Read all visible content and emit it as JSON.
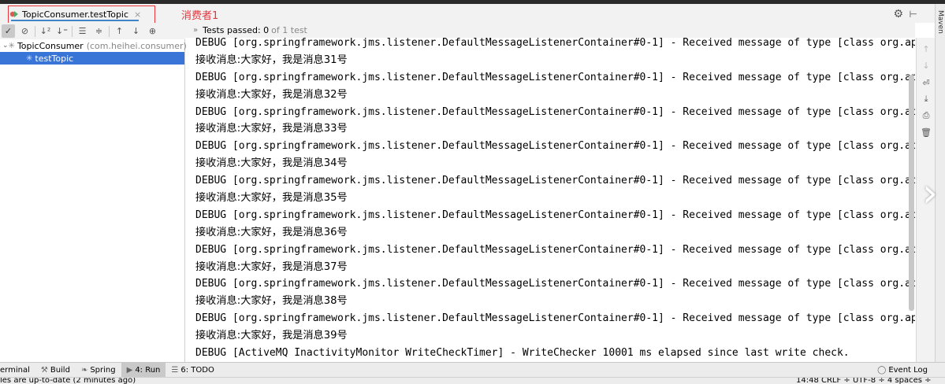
{
  "run_tab": {
    "title": "TopicConsumer.testTopic",
    "close_glyph": "×"
  },
  "annotation": {
    "label": "消费者1",
    "color": "#e8343b"
  },
  "right_strip": {
    "label": "Maven"
  },
  "test_status": {
    "prefix": "»",
    "main": "Tests passed: 0",
    "sub": "of 1 test"
  },
  "test_tree": {
    "root_label": "TopicConsumer",
    "root_package": "(com.heihei.consumer)",
    "child_label": "testTopic"
  },
  "console": {
    "lines": [
      {
        "kind": "debug",
        "text": "DEBUG [org.springframework.jms.listener.DefaultMessageListenerContainer#0-1] - Received message of type [class org.apa"
      },
      {
        "kind": "recv",
        "text": "接收消息:大家好，我是消息31号"
      },
      {
        "kind": "debug",
        "text": "DEBUG [org.springframework.jms.listener.DefaultMessageListenerContainer#0-1] - Received message of type [class org.apa"
      },
      {
        "kind": "recv",
        "text": "接收消息:大家好，我是消息32号"
      },
      {
        "kind": "debug",
        "text": "DEBUG [org.springframework.jms.listener.DefaultMessageListenerContainer#0-1] - Received message of type [class org.apa"
      },
      {
        "kind": "recv",
        "text": "接收消息:大家好，我是消息33号"
      },
      {
        "kind": "debug",
        "text": "DEBUG [org.springframework.jms.listener.DefaultMessageListenerContainer#0-1] - Received message of type [class org.apa"
      },
      {
        "kind": "recv",
        "text": "接收消息:大家好，我是消息34号"
      },
      {
        "kind": "debug",
        "text": "DEBUG [org.springframework.jms.listener.DefaultMessageListenerContainer#0-1] - Received message of type [class org.apa"
      },
      {
        "kind": "recv",
        "text": "接收消息:大家好，我是消息35号"
      },
      {
        "kind": "debug",
        "text": "DEBUG [org.springframework.jms.listener.DefaultMessageListenerContainer#0-1] - Received message of type [class org.apa"
      },
      {
        "kind": "recv",
        "text": "接收消息:大家好，我是消息36号"
      },
      {
        "kind": "debug",
        "text": "DEBUG [org.springframework.jms.listener.DefaultMessageListenerContainer#0-1] - Received message of type [class org.apa"
      },
      {
        "kind": "recv",
        "text": "接收消息:大家好，我是消息37号"
      },
      {
        "kind": "debug",
        "text": "DEBUG [org.springframework.jms.listener.DefaultMessageListenerContainer#0-1] - Received message of type [class org.apa"
      },
      {
        "kind": "recv",
        "text": "接收消息:大家好，我是消息38号"
      },
      {
        "kind": "debug",
        "text": "DEBUG [org.springframework.jms.listener.DefaultMessageListenerContainer#0-1] - Received message of type [class org.apa"
      },
      {
        "kind": "recv",
        "text": "接收消息:大家好，我是消息39号"
      },
      {
        "kind": "debug",
        "text": "DEBUG [ActiveMQ InactivityMonitor WriteCheckTimer] - WriteChecker 10001 ms elapsed since last write check."
      }
    ]
  },
  "bottom_tools": {
    "terminal": "erminal",
    "build": "Build",
    "spring": "Spring",
    "run": "4: Run",
    "todo": "6: TODO",
    "event_log": "Event Log"
  },
  "status_line": {
    "left": "les are up-to-date (2 minutes ago)",
    "right": "14:48   CRLF ÷   UTF-8 ÷   4 spaces ÷"
  },
  "colors": {
    "selection": "#3875d7",
    "tab_underline": "#4083c9",
    "panel_bg": "#f2f2f2"
  }
}
